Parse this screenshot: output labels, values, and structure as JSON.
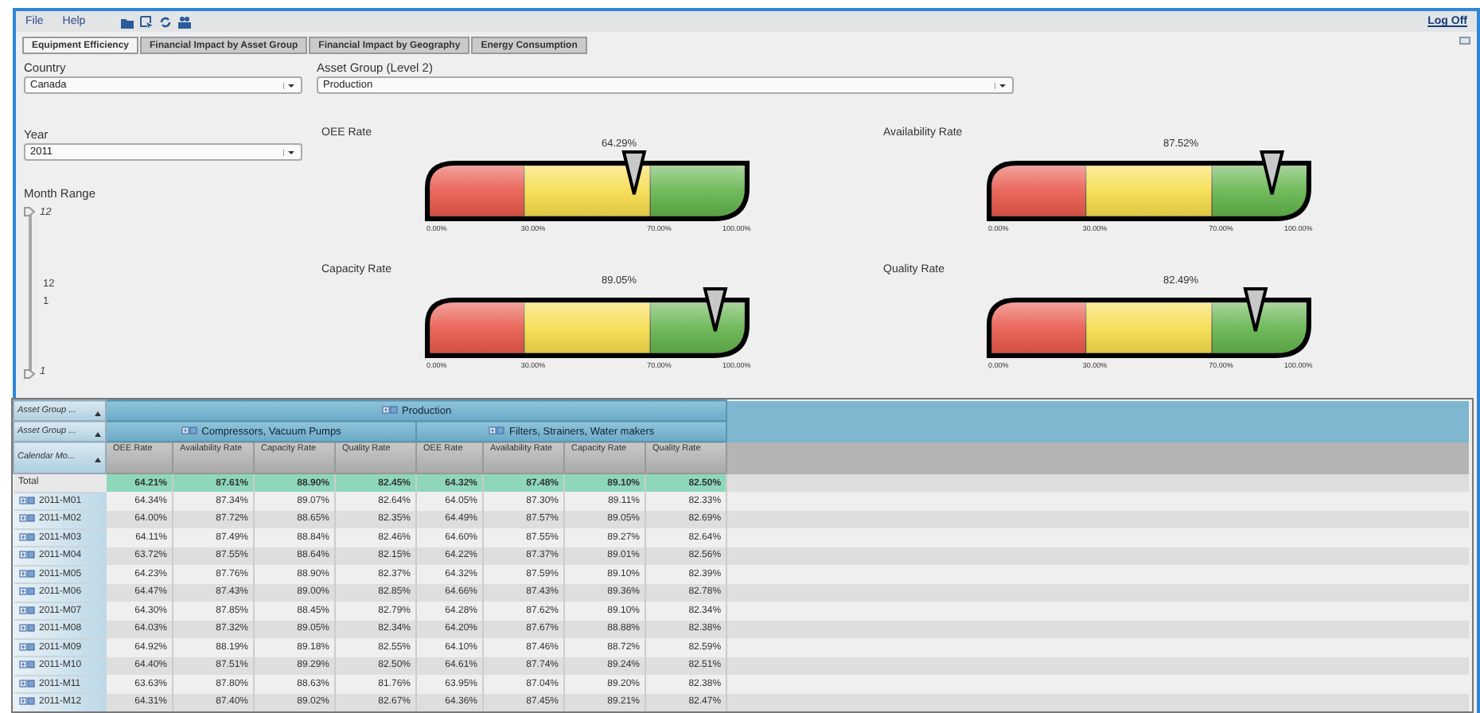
{
  "menu": [
    "File",
    "Help"
  ],
  "log_off": "Log Off",
  "tabs": [
    {
      "label": "Equipment Efficiency",
      "selected": true
    },
    {
      "label": "Financial Impact by Asset Group",
      "selected": false
    },
    {
      "label": "Financial Impact by Geography",
      "selected": false
    },
    {
      "label": "Energy Consumption",
      "selected": false
    }
  ],
  "filters": {
    "country": {
      "label": "Country",
      "value": "Canada"
    },
    "asset_group": {
      "label": "Asset Group (Level 2)",
      "value": "Production"
    },
    "year": {
      "label": "Year",
      "value": "2011"
    }
  },
  "month_range": {
    "label": "Month Range",
    "top_thumb": "12",
    "bottom_thumb": "1",
    "from": "12",
    "to": "1",
    "level": 1
  },
  "gauges": [
    {
      "title": "OEE Rate",
      "value": "64.29%",
      "level": 0.6429,
      "ticks": [
        "0.00%",
        "30.00%",
        "70.00%",
        "100.00%"
      ]
    },
    {
      "title": "Availability Rate",
      "value": "87.52%",
      "level": 0.8752,
      "ticks": [
        "0.00%",
        "30.00%",
        "70.00%",
        "100.00%"
      ]
    },
    {
      "title": "Capacity Rate",
      "value": "89.05%",
      "level": 0.8905,
      "ticks": [
        "0.00%",
        "30.00%",
        "70.00%",
        "100.00%"
      ]
    },
    {
      "title": "Quality Rate",
      "value": "82.49%",
      "level": 0.8249,
      "ticks": [
        "0.00%",
        "30.00%",
        "70.00%",
        "100.00%"
      ]
    }
  ],
  "table": {
    "dimension_headers": [
      "Asset Group ...",
      "Asset Group ...",
      "Calendar Mo..."
    ],
    "group": "Production",
    "subgroups": [
      "Compressors, Vacuum Pumps",
      "Filters, Strainers, Water makers"
    ],
    "columns": [
      "OEE Rate",
      "Availability Rate",
      "Capacity Rate",
      "Quality Rate",
      "OEE Rate",
      "Availability Rate",
      "Capacity Rate",
      "Quality Rate"
    ],
    "rows": [
      {
        "kind": "total",
        "label": "Total",
        "values": [
          "64.21%",
          "87.61%",
          "88.90%",
          "82.45%",
          "64.32%",
          "87.48%",
          "89.10%",
          "82.50%"
        ]
      },
      {
        "kind": "member",
        "label": "2011-M01",
        "values": [
          "64.34%",
          "87.34%",
          "89.07%",
          "82.64%",
          "64.05%",
          "87.30%",
          "89.11%",
          "82.33%"
        ]
      },
      {
        "kind": "member",
        "label": "2011-M02",
        "values": [
          "64.00%",
          "87.72%",
          "88.65%",
          "82.35%",
          "64.49%",
          "87.57%",
          "89.05%",
          "82.69%"
        ]
      },
      {
        "kind": "member",
        "label": "2011-M03",
        "values": [
          "64.11%",
          "87.49%",
          "88.84%",
          "82.46%",
          "64.60%",
          "87.55%",
          "89.27%",
          "82.64%"
        ]
      },
      {
        "kind": "member",
        "label": "2011-M04",
        "values": [
          "63.72%",
          "87.55%",
          "88.64%",
          "82.15%",
          "64.22%",
          "87.37%",
          "89.01%",
          "82.56%"
        ]
      },
      {
        "kind": "member",
        "label": "2011-M05",
        "values": [
          "64.23%",
          "87.76%",
          "88.90%",
          "82.37%",
          "64.32%",
          "87.59%",
          "89.10%",
          "82.39%"
        ]
      },
      {
        "kind": "member",
        "label": "2011-M06",
        "values": [
          "64.47%",
          "87.43%",
          "89.00%",
          "82.85%",
          "64.66%",
          "87.43%",
          "89.36%",
          "82.78%"
        ]
      },
      {
        "kind": "member",
        "label": "2011-M07",
        "values": [
          "64.30%",
          "87.85%",
          "88.45%",
          "82.79%",
          "64.28%",
          "87.62%",
          "89.10%",
          "82.34%"
        ]
      },
      {
        "kind": "member",
        "label": "2011-M08",
        "values": [
          "64.03%",
          "87.32%",
          "89.05%",
          "82.34%",
          "64.20%",
          "87.67%",
          "88.88%",
          "82.38%"
        ]
      },
      {
        "kind": "member",
        "label": "2011-M09",
        "values": [
          "64.92%",
          "88.19%",
          "89.18%",
          "82.55%",
          "64.10%",
          "87.46%",
          "88.72%",
          "82.59%"
        ]
      },
      {
        "kind": "member",
        "label": "2011-M10",
        "values": [
          "64.40%",
          "87.51%",
          "89.29%",
          "82.50%",
          "64.61%",
          "87.74%",
          "89.24%",
          "82.51%"
        ]
      },
      {
        "kind": "member",
        "label": "2011-M11",
        "values": [
          "63.63%",
          "87.80%",
          "88.63%",
          "81.76%",
          "63.95%",
          "87.04%",
          "89.20%",
          "82.38%"
        ]
      },
      {
        "kind": "member",
        "label": "2011-M12",
        "values": [
          "64.31%",
          "87.40%",
          "89.02%",
          "82.67%",
          "64.36%",
          "87.45%",
          "89.21%",
          "82.47%"
        ]
      }
    ]
  }
}
